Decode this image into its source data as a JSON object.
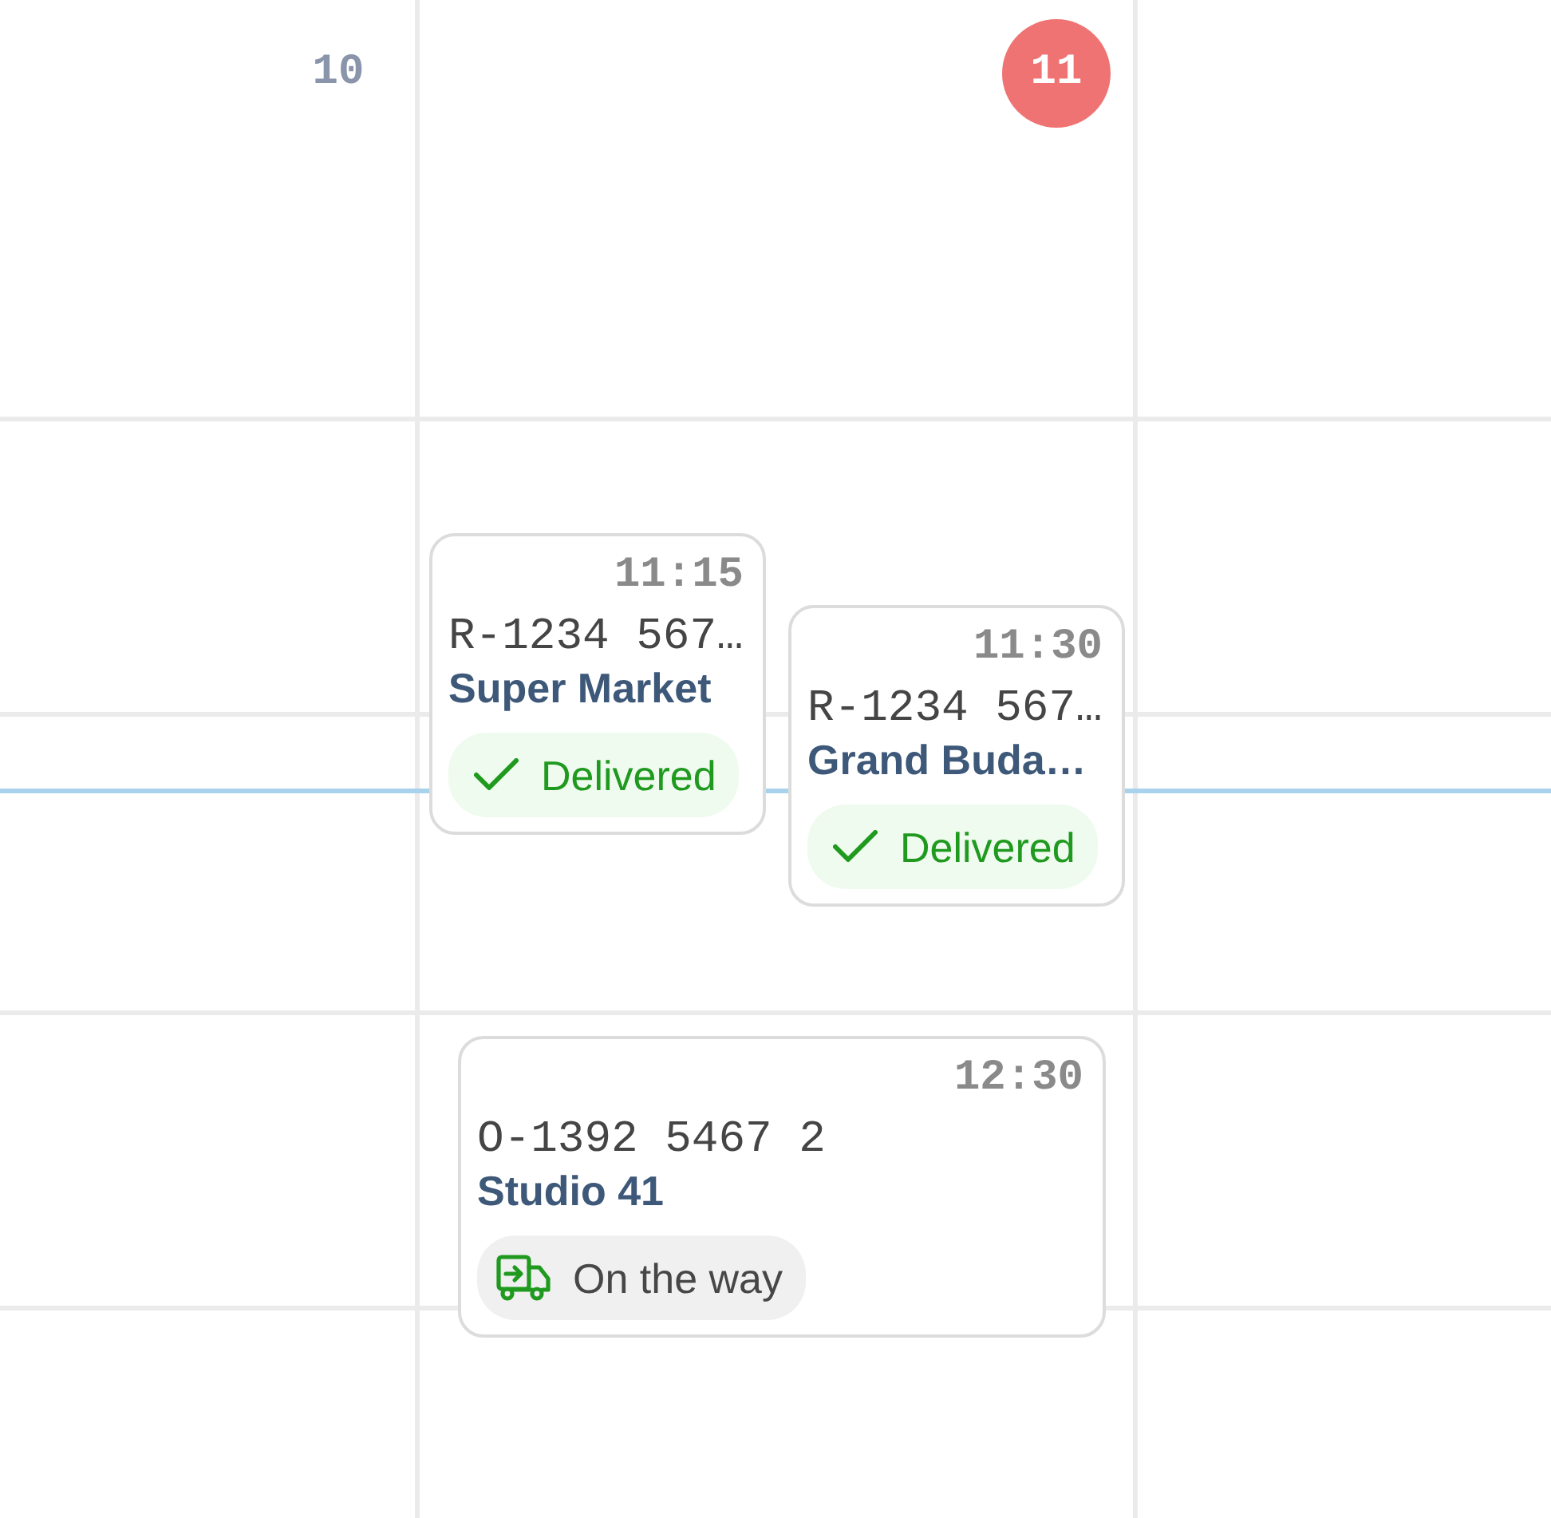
{
  "days": [
    {
      "number": "10",
      "today": false
    },
    {
      "number": "11",
      "today": true,
      "events": [
        {
          "time": "11:15",
          "order": "R-1234 567…",
          "customer": "Super Market",
          "status": {
            "kind": "delivered",
            "label": "Delivered"
          }
        },
        {
          "time": "11:30",
          "order": "R-1234 567…",
          "customer": "Grand Buda…",
          "status": {
            "kind": "delivered",
            "label": "Delivered"
          }
        },
        {
          "time": "12:30",
          "order": "O-1392 5467 2",
          "customer": "Studio 41",
          "status": {
            "kind": "on_the_way",
            "label": "On the way"
          }
        }
      ]
    }
  ]
}
